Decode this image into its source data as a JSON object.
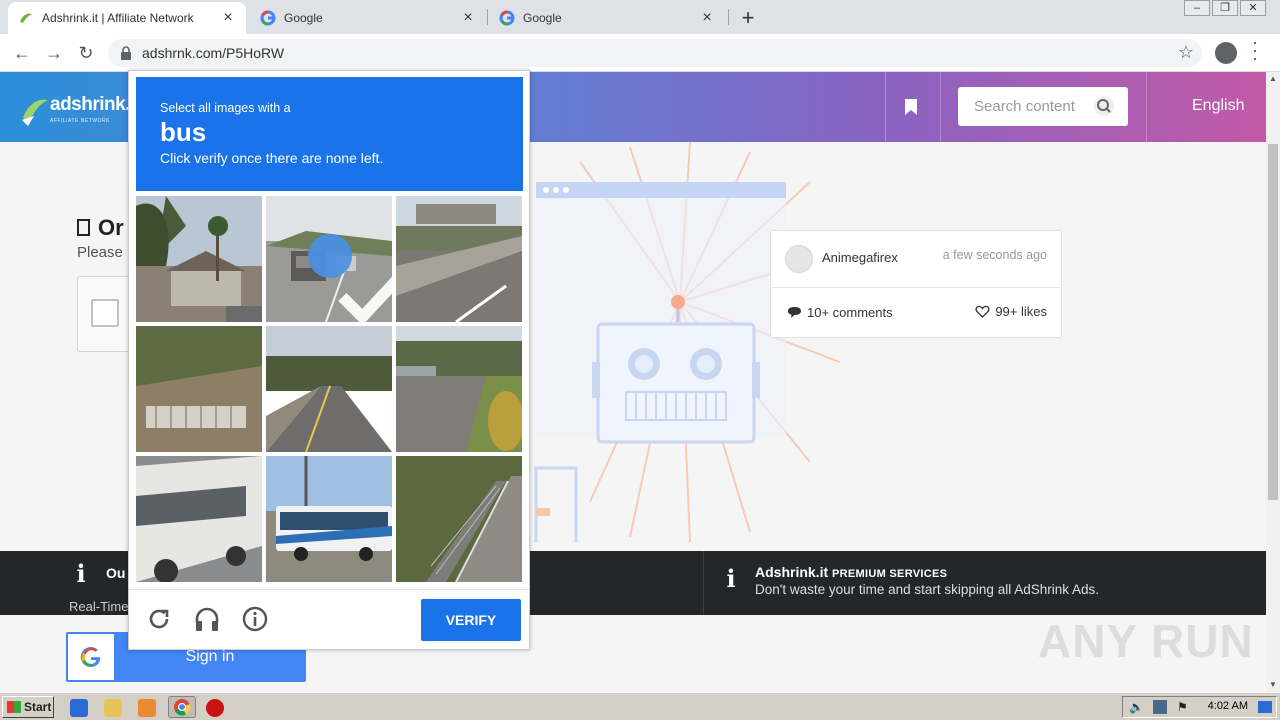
{
  "browser": {
    "tabs": [
      {
        "title": "Adshrink.it | Affiliate Network",
        "favicon": "adshrink-favicon"
      },
      {
        "title": "Google",
        "favicon": "google-favicon"
      },
      {
        "title": "Google",
        "favicon": "google-favicon"
      }
    ],
    "url": "adshrnk.com/P5HoRW",
    "controls": {
      "back": "←",
      "forward": "→",
      "reload": "↻",
      "star": "☆",
      "newtab": "+",
      "close": "×"
    }
  },
  "site": {
    "logo_text": "adshrink.it",
    "logo_sub": "AFFILIATE NETWORK",
    "search_placeholder": "Search content",
    "language": "English",
    "heading_partial": "Or",
    "subtext_partial": "Please",
    "post": {
      "author": "Animegafirex",
      "time": "a few seconds ago",
      "comments": "10+ comments",
      "likes": "99+ likes"
    },
    "info_left_title_partial": "Ou",
    "info_left_sub_partial": "Real-Time",
    "info_right_brand": "Adshrink.it",
    "info_right_title": "PREMIUM SERVICES",
    "info_right_sub": "Don't waste your time and start skipping all AdShrink Ads.",
    "signin_label": "Sign in",
    "watermark": "ANY RUN"
  },
  "captcha": {
    "instruction": "Select all images with a",
    "target": "bus",
    "hint": "Click verify once there are none left.",
    "verify_label": "VERIFY",
    "tiles": [
      {
        "scene": "house-palm",
        "selected": false
      },
      {
        "scene": "highway-cars",
        "selected": true
      },
      {
        "scene": "road-parking",
        "selected": false
      },
      {
        "scene": "dirt-fence",
        "selected": false
      },
      {
        "scene": "road-trees",
        "selected": false
      },
      {
        "scene": "street-curb",
        "selected": false
      },
      {
        "scene": "bus-closeup",
        "selected": false
      },
      {
        "scene": "bus-street",
        "selected": false
      },
      {
        "scene": "bridge-road",
        "selected": false
      }
    ],
    "icons": [
      "reload-icon",
      "audio-icon",
      "info-icon"
    ]
  },
  "taskbar": {
    "start_label": "Start",
    "clock": "4:02 AM"
  },
  "colors": {
    "captcha_blue": "#1a73e8",
    "header_gradient_start": "#2c8fd8",
    "header_gradient_end": "#c259a6",
    "dark_bar": "#24272a"
  }
}
